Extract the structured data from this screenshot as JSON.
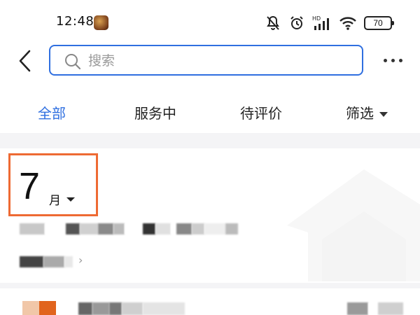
{
  "status_bar": {
    "time": "12:48",
    "battery_level": "70",
    "icons": [
      "app-icon",
      "mute-icon",
      "alarm-icon",
      "hd-signal-icon",
      "wifi-icon",
      "battery-icon"
    ]
  },
  "header": {
    "back_icon": "chevron-left-icon",
    "search": {
      "placeholder": "搜索",
      "value": ""
    },
    "more_icon": "more-dots-icon"
  },
  "tabs": [
    {
      "label": "全部",
      "active": true
    },
    {
      "label": "服务中",
      "active": false
    },
    {
      "label": "待评价",
      "active": false
    },
    {
      "label": "筛选",
      "active": false,
      "icon": "caret-down-icon"
    }
  ],
  "month_section": {
    "month": "7",
    "unit": "月",
    "caret_icon": "caret-down-icon",
    "highlight_color": "#ee6a33"
  },
  "colors": {
    "accent": "#2f6fe0",
    "highlight": "#ee6a33",
    "logo_orange": "#e1641d"
  }
}
